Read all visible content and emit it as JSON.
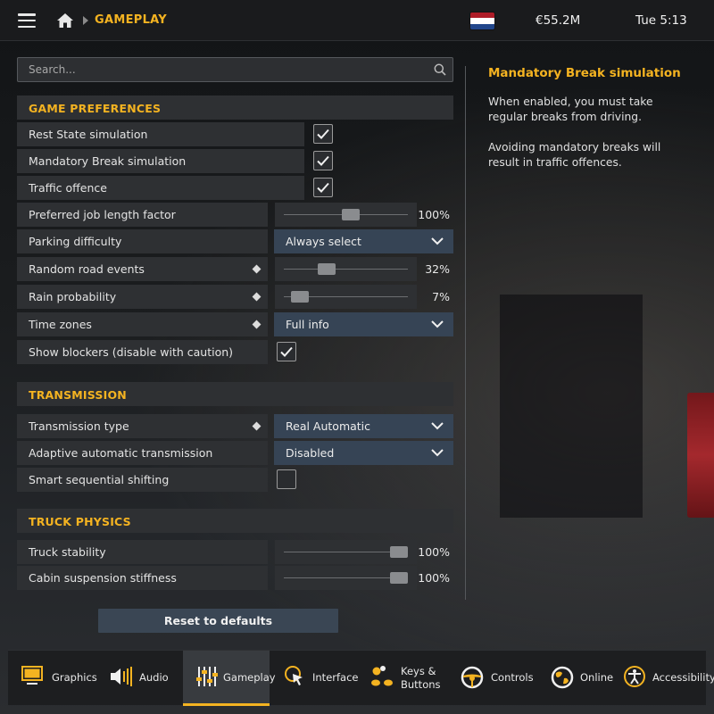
{
  "header": {
    "breadcrumb": "GAMEPLAY",
    "money": "€55.2M",
    "clock": "Tue 5:13",
    "flag_colors": [
      "#ae1c28",
      "#ffffff",
      "#21468b"
    ],
    "accent": "#f4b321"
  },
  "search": {
    "placeholder": "Search..."
  },
  "sections": {
    "game_prefs": "GAME PREFERENCES",
    "transmission": "TRANSMISSION",
    "truck_physics": "TRUCK PHYSICS"
  },
  "settings": {
    "rest_state": {
      "label": "Rest State simulation",
      "checked": true
    },
    "mandatory_break": {
      "label": "Mandatory Break simulation",
      "checked": true
    },
    "traffic_offence": {
      "label": "Traffic offence",
      "checked": true
    },
    "job_length": {
      "label": "Preferred job length factor",
      "value": "100%",
      "level": 0.55
    },
    "parking": {
      "label": "Parking difficulty",
      "value": "Always select"
    },
    "road_events": {
      "label": "Random road events",
      "value": "32%",
      "level": 0.32
    },
    "rain": {
      "label": "Rain probability",
      "value": "7%",
      "level": 0.07
    },
    "time_zones": {
      "label": "Time zones",
      "value": "Full info"
    },
    "blockers": {
      "label": "Show blockers (disable with caution)",
      "checked": true
    },
    "trans_type": {
      "label": "Transmission type",
      "value": "Real Automatic"
    },
    "adaptive": {
      "label": "Adaptive automatic transmission",
      "value": "Disabled"
    },
    "smart_seq": {
      "label": "Smart sequential shifting",
      "checked": false
    },
    "truck_stability": {
      "label": "Truck stability",
      "value": "100%",
      "level": 1.0
    },
    "cabin_suspension": {
      "label": "Cabin suspension stiffness",
      "value": "100%",
      "level": 1.0
    }
  },
  "reset_label": "Reset to defaults",
  "info": {
    "title": "Mandatory Break simulation",
    "p1": "When enabled, you must take regular breaks from driving.",
    "p2": "Avoiding mandatory breaks will result in traffic offences."
  },
  "nav": {
    "graphics": "Graphics",
    "audio": "Audio",
    "gameplay": "Gameplay",
    "interface": "Interface",
    "keys_line1": "Keys &",
    "keys_line2": "Buttons",
    "controls": "Controls",
    "online": "Online",
    "accessibility": "Accessibility"
  }
}
